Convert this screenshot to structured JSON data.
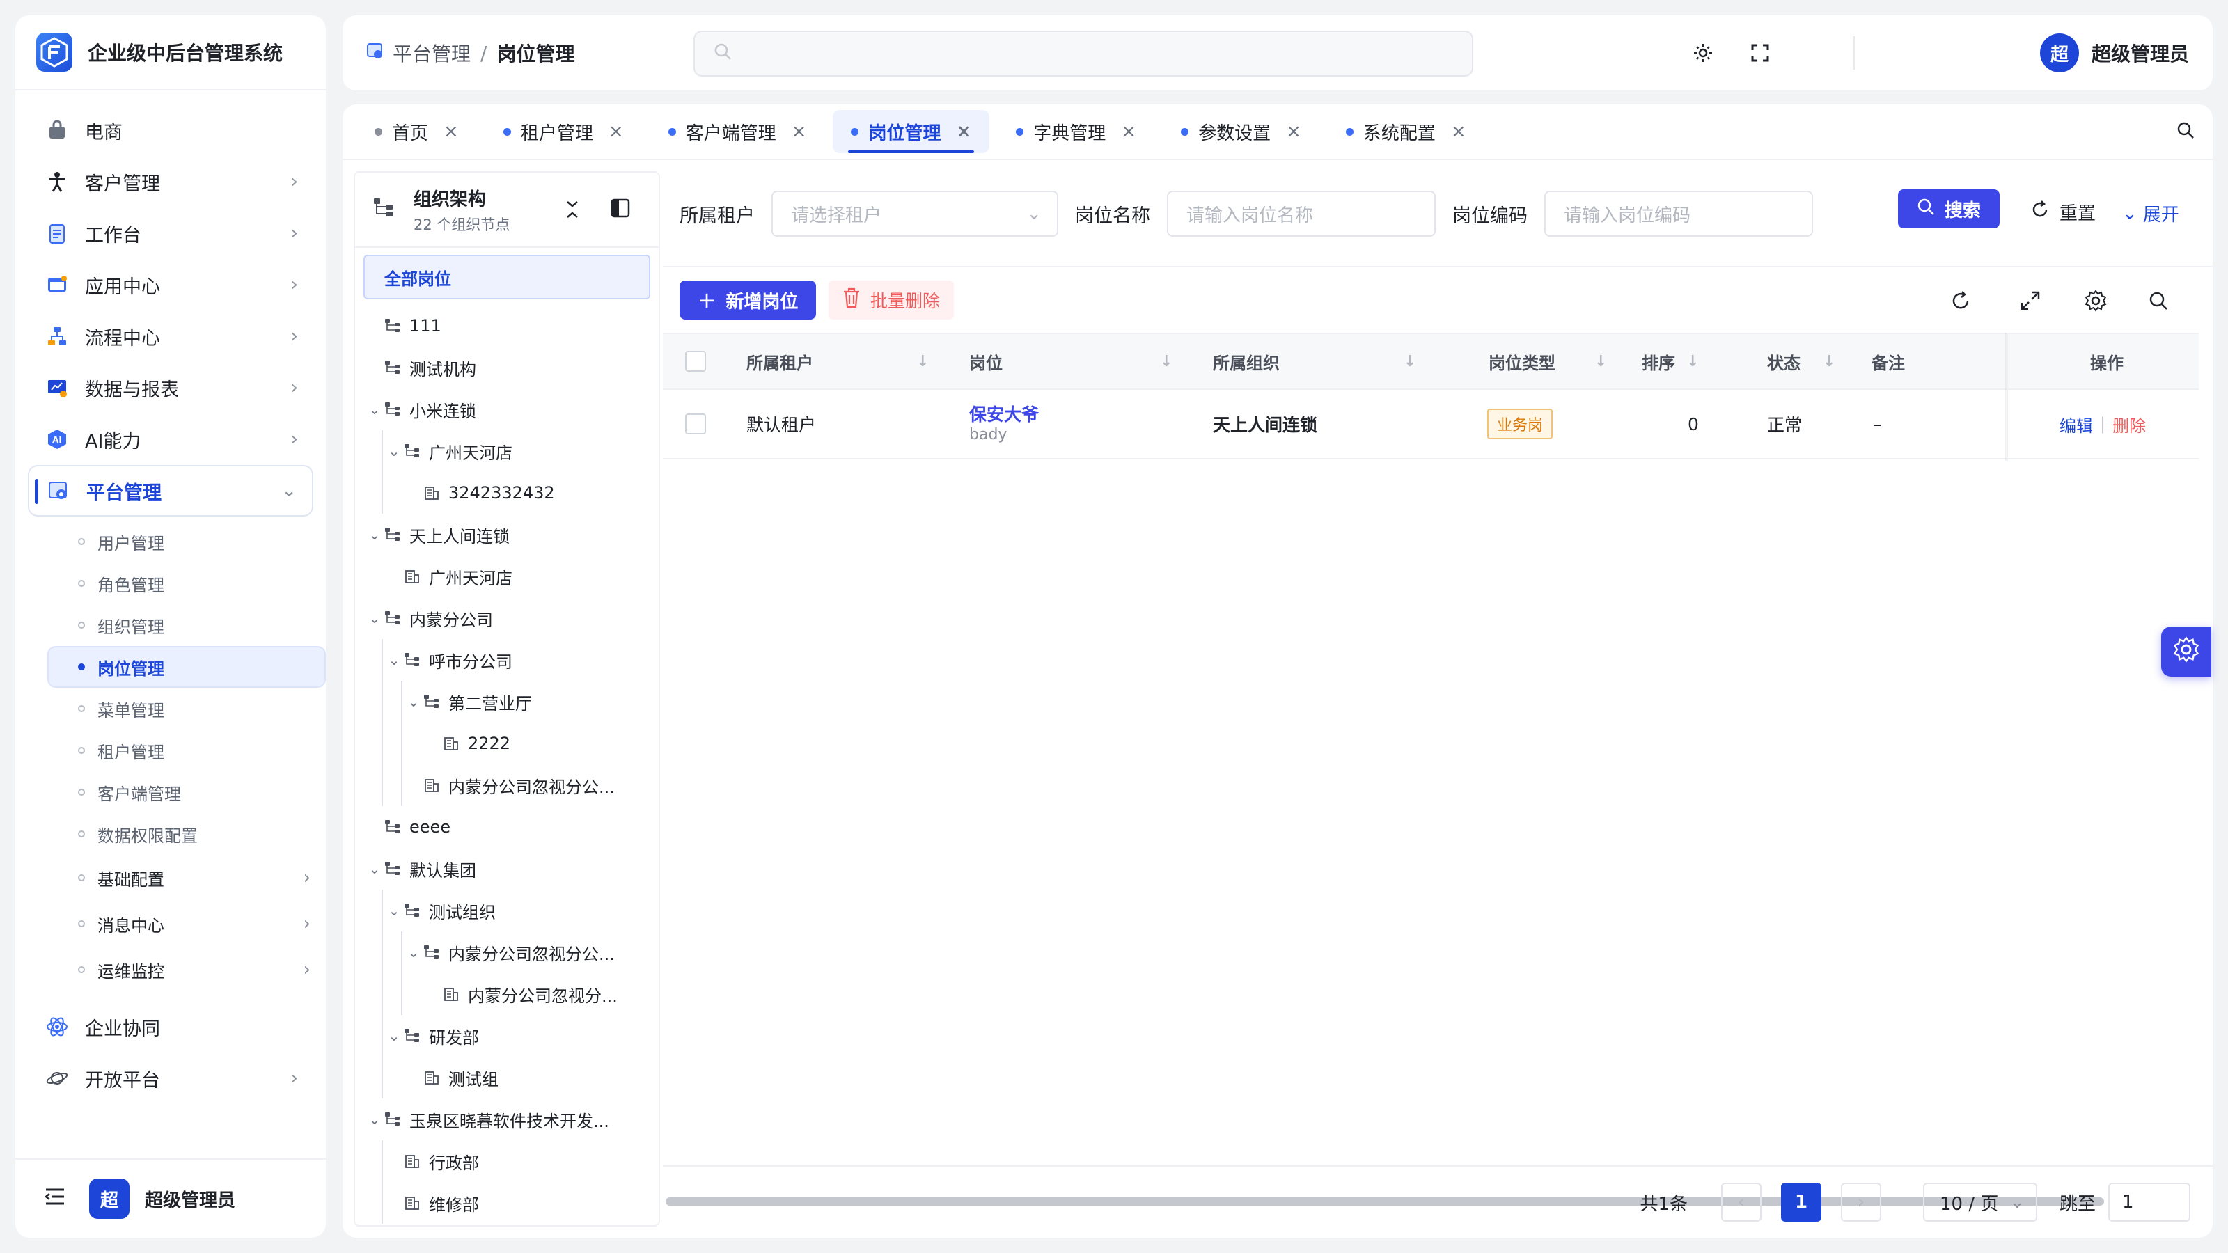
{
  "app": {
    "title": "企业级中后台管理系统",
    "logo_text": "F"
  },
  "sidebar": {
    "menu": [
      {
        "label": "电商",
        "icon": "bag-icon",
        "arrow": false
      },
      {
        "label": "客户管理",
        "icon": "person-icon",
        "arrow": true
      },
      {
        "label": "工作台",
        "icon": "clipboard-icon",
        "arrow": true
      },
      {
        "label": "应用中心",
        "icon": "app-window-icon",
        "arrow": true
      },
      {
        "label": "流程中心",
        "icon": "flow-icon",
        "arrow": true
      },
      {
        "label": "数据与报表",
        "icon": "chart-icon",
        "arrow": true
      },
      {
        "label": "AI能力",
        "icon": "ai-icon",
        "arrow": true
      },
      {
        "label": "平台管理",
        "icon": "platform-icon",
        "arrow": "down",
        "active": true
      }
    ],
    "submenu": [
      {
        "label": "用户管理"
      },
      {
        "label": "角色管理"
      },
      {
        "label": "组织管理"
      },
      {
        "label": "岗位管理",
        "active": true
      },
      {
        "label": "菜单管理"
      },
      {
        "label": "租户管理"
      },
      {
        "label": "客户端管理"
      },
      {
        "label": "数据权限配置"
      },
      {
        "label": "基础配置",
        "arrow": true
      },
      {
        "label": "消息中心",
        "arrow": true
      },
      {
        "label": "运维监控",
        "arrow": true
      }
    ],
    "bottom_menu": [
      {
        "label": "企业协同",
        "icon": "atom-icon"
      },
      {
        "label": "开放平台",
        "icon": "planet-icon",
        "arrow": true
      }
    ],
    "footer": {
      "avatar": "超",
      "name": "超级管理员"
    }
  },
  "header": {
    "breadcrumb": [
      "平台管理",
      "岗位管理"
    ],
    "search_placeholder": "",
    "user": {
      "avatar": "超",
      "name": "超级管理员"
    }
  },
  "tabs": [
    {
      "label": "首页",
      "dot": "gray"
    },
    {
      "label": "租户管理"
    },
    {
      "label": "客户端管理"
    },
    {
      "label": "岗位管理",
      "active": true
    },
    {
      "label": "字典管理"
    },
    {
      "label": "参数设置"
    },
    {
      "label": "系统配置"
    }
  ],
  "tree": {
    "title": "组织架构",
    "subtitle": "22 个组织节点",
    "all_label": "全部岗位",
    "nodes": [
      {
        "label": "111",
        "level": 1,
        "caret": false,
        "icon": "org"
      },
      {
        "label": "测试机构",
        "level": 1,
        "caret": false,
        "icon": "org"
      },
      {
        "label": "小米连锁",
        "level": 1,
        "caret": true,
        "icon": "org"
      },
      {
        "label": "广州天河店",
        "level": 2,
        "caret": true,
        "icon": "org"
      },
      {
        "label": "3242332432",
        "level": 3,
        "caret": false,
        "icon": "dept"
      },
      {
        "label": "天上人间连锁",
        "level": 1,
        "caret": true,
        "icon": "org"
      },
      {
        "label": "广州天河店",
        "level": 2,
        "caret": false,
        "icon": "dept"
      },
      {
        "label": "内蒙分公司",
        "level": 1,
        "caret": true,
        "icon": "org"
      },
      {
        "label": "呼市分公司",
        "level": 2,
        "caret": true,
        "icon": "org"
      },
      {
        "label": "第二营业厅",
        "level": 3,
        "caret": true,
        "icon": "org"
      },
      {
        "label": "2222",
        "level": 4,
        "caret": false,
        "icon": "dept"
      },
      {
        "label": "内蒙分公司忽视分公...",
        "level": 3,
        "caret": false,
        "icon": "dept"
      },
      {
        "label": "eeee",
        "level": 1,
        "caret": false,
        "icon": "org"
      },
      {
        "label": "默认集团",
        "level": 1,
        "caret": true,
        "icon": "org"
      },
      {
        "label": "测试组织",
        "level": 2,
        "caret": true,
        "icon": "org"
      },
      {
        "label": "内蒙分公司忽视分公...",
        "level": 3,
        "caret": true,
        "icon": "org"
      },
      {
        "label": "内蒙分公司忽视分...",
        "level": 4,
        "caret": false,
        "icon": "dept"
      },
      {
        "label": "研发部",
        "level": 2,
        "caret": true,
        "icon": "org"
      },
      {
        "label": "测试组",
        "level": 3,
        "caret": false,
        "icon": "dept"
      },
      {
        "label": "玉泉区晓暮软件技术开发...",
        "level": 1,
        "caret": true,
        "icon": "org"
      },
      {
        "label": "行政部",
        "level": 2,
        "caret": false,
        "icon": "dept"
      },
      {
        "label": "维修部",
        "level": 2,
        "caret": false,
        "icon": "dept"
      }
    ]
  },
  "filters": {
    "tenant_label": "所属租户",
    "tenant_placeholder": "请选择租户",
    "name_label": "岗位名称",
    "name_placeholder": "请输入岗位名称",
    "code_label": "岗位编码",
    "code_placeholder": "请输入岗位编码",
    "search": "搜索",
    "reset": "重置",
    "expand": "展开"
  },
  "toolbar": {
    "add": "新增岗位",
    "batch_delete": "批量删除"
  },
  "table": {
    "columns": [
      "所属租户",
      "岗位",
      "所属组织",
      "岗位类型",
      "排序",
      "状态",
      "备注",
      "操作"
    ],
    "rows": [
      {
        "tenant": "默认租户",
        "post": "保安大爷",
        "code": "bady",
        "org": "天上人间连锁",
        "type": "业务岗",
        "sort": "0",
        "status": "正常",
        "remark": "–",
        "edit": "编辑",
        "delete": "删除"
      }
    ]
  },
  "pagination": {
    "total": "共1条",
    "current": "1",
    "page_size": "10 / 页",
    "jump_label": "跳至",
    "jump_value": "1"
  },
  "colors": {
    "primary": "#3d47e8",
    "accent": "#1d46d9",
    "danger": "#f05a5a",
    "warning": "#d97706"
  }
}
